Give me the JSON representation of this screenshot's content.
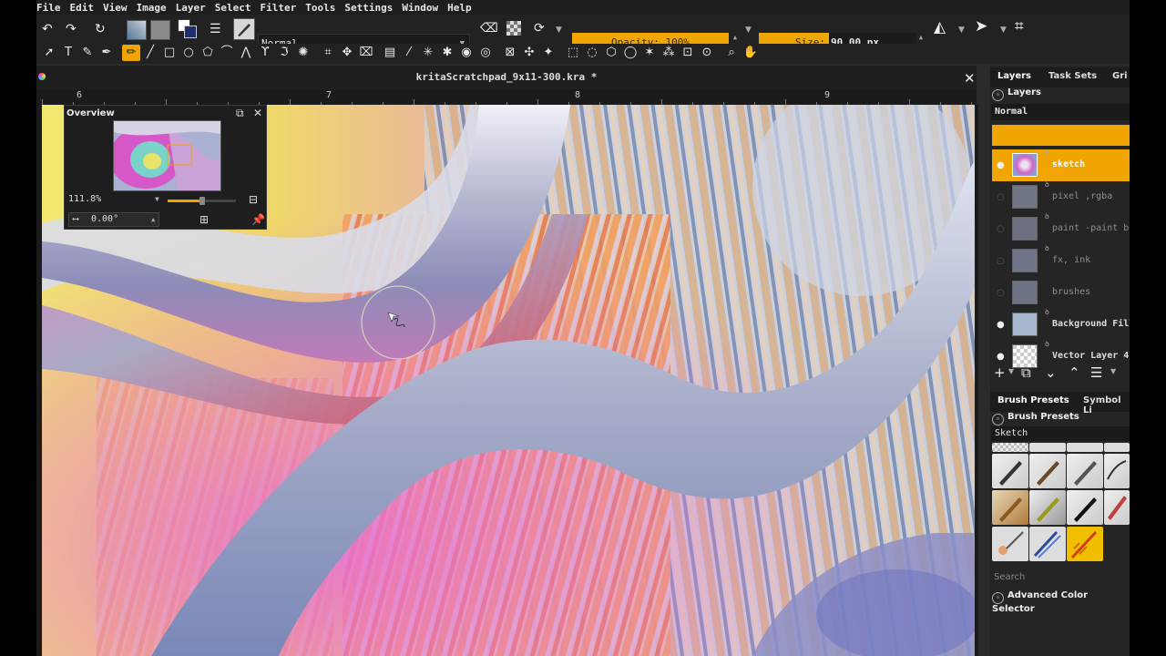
{
  "menu": [
    "File",
    "Edit",
    "View",
    "Image",
    "Layer",
    "Select",
    "Filter",
    "Tools",
    "Settings",
    "Window",
    "Help"
  ],
  "toolbar": {
    "blend_mode": "Normal",
    "opacity_label": "Opacity: 100%",
    "size_label": "Size:",
    "size_value": "90.00 px"
  },
  "document": {
    "title": "kritaScratchpad_9x11-300.kra *",
    "ruler_labels": [
      "6",
      "7",
      "8",
      "9"
    ]
  },
  "overview": {
    "title": "Overview",
    "zoom": "111.8%",
    "rotation": "0.00°",
    "zoom_slider_fraction": 0.5
  },
  "layers_panel": {
    "tabs": [
      "Layers",
      "Task Sets",
      "Gri"
    ],
    "header": "Layers",
    "blend_mode": "Normal",
    "layers": [
      {
        "name": "sketch",
        "active": true,
        "visible": true
      },
      {
        "name": "pixel ,rgba",
        "active": false,
        "visible": false
      },
      {
        "name": "paint -paint br",
        "active": false,
        "visible": false
      },
      {
        "name": "fx, ink",
        "active": false,
        "visible": false
      },
      {
        "name": "brushes",
        "active": false,
        "visible": false
      },
      {
        "name": "Background Fill",
        "active": false,
        "visible": true
      },
      {
        "name": "Vector Layer 4",
        "active": false,
        "visible": true
      }
    ]
  },
  "brush_panel": {
    "tabs": [
      "Brush Presets",
      "Symbol Li"
    ],
    "header": "Brush Presets",
    "tag": "Sketch",
    "search_label": "Search"
  },
  "color_panel": {
    "header": "Advanced Color Selector"
  },
  "colors": {
    "accent": "#f0a500",
    "panel_bg": "#252525"
  }
}
